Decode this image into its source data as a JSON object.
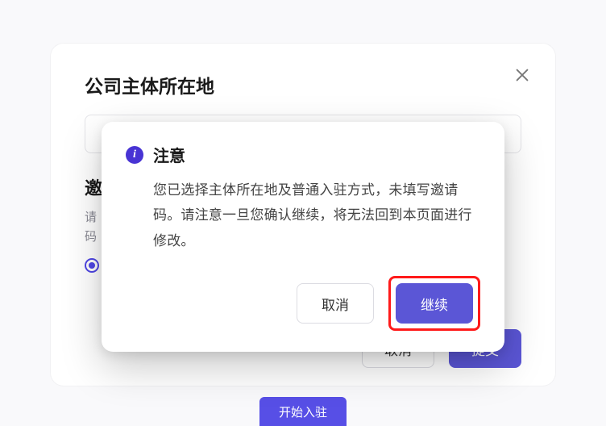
{
  "bg": {
    "title": "公司主体所在地",
    "input_value": "",
    "section2_label": "邀",
    "help_line1": "请",
    "help_line2": "码",
    "cancel": "取消",
    "submit": "提交",
    "start": "开始入驻"
  },
  "confirm": {
    "icon_glyph": "i",
    "title": "注意",
    "body": "您已选择主体所在地及普通入驻方式，未填写邀请码。请注意一旦您确认继续，将无法回到本页面进行修改。",
    "cancel": "取消",
    "continue": "继续"
  }
}
